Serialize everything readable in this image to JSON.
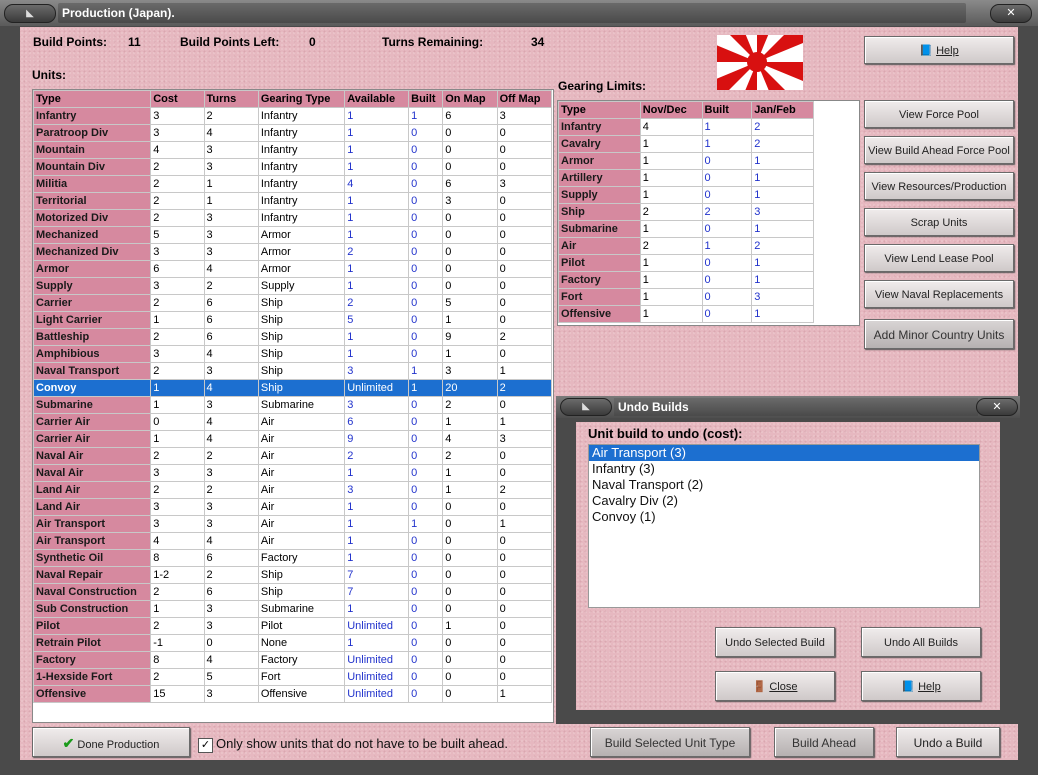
{
  "window": {
    "title": "Production (Japan).",
    "close_glyph": "✕"
  },
  "header": {
    "build_points_label": "Build Points:",
    "build_points": "11",
    "build_points_left_label": "Build Points Left:",
    "build_points_left": "0",
    "turns_remaining_label": "Turns Remaining:",
    "turns_remaining": "34"
  },
  "units": {
    "label": "Units:",
    "columns": [
      "Type",
      "Cost",
      "Turns",
      "Gearing Type",
      "Available",
      "Built",
      "On Map",
      "Off Map"
    ],
    "selected_index": 16,
    "rows": [
      [
        "Infantry",
        "3",
        "2",
        "Infantry",
        "1",
        "1",
        "6",
        "3"
      ],
      [
        "Paratroop Div",
        "3",
        "4",
        "Infantry",
        "1",
        "0",
        "0",
        "0"
      ],
      [
        "Mountain",
        "4",
        "3",
        "Infantry",
        "1",
        "0",
        "0",
        "0"
      ],
      [
        "Mountain Div",
        "2",
        "3",
        "Infantry",
        "1",
        "0",
        "0",
        "0"
      ],
      [
        "Militia",
        "2",
        "1",
        "Infantry",
        "4",
        "0",
        "6",
        "3"
      ],
      [
        "Territorial",
        "2",
        "1",
        "Infantry",
        "1",
        "0",
        "3",
        "0"
      ],
      [
        "Motorized Div",
        "2",
        "3",
        "Infantry",
        "1",
        "0",
        "0",
        "0"
      ],
      [
        "Mechanized",
        "5",
        "3",
        "Armor",
        "1",
        "0",
        "0",
        "0"
      ],
      [
        "Mechanized Div",
        "3",
        "3",
        "Armor",
        "2",
        "0",
        "0",
        "0"
      ],
      [
        "Armor",
        "6",
        "4",
        "Armor",
        "1",
        "0",
        "0",
        "0"
      ],
      [
        "Supply",
        "3",
        "2",
        "Supply",
        "1",
        "0",
        "0",
        "0"
      ],
      [
        "Carrier",
        "2",
        "6",
        "Ship",
        "2",
        "0",
        "5",
        "0"
      ],
      [
        "Light Carrier",
        "1",
        "6",
        "Ship",
        "5",
        "0",
        "1",
        "0"
      ],
      [
        "Battleship",
        "2",
        "6",
        "Ship",
        "1",
        "0",
        "9",
        "2"
      ],
      [
        "Amphibious",
        "3",
        "4",
        "Ship",
        "1",
        "0",
        "1",
        "0"
      ],
      [
        "Naval Transport",
        "2",
        "3",
        "Ship",
        "3",
        "1",
        "3",
        "1"
      ],
      [
        "Convoy",
        "1",
        "4",
        "Ship",
        "Unlimited",
        "1",
        "20",
        "2"
      ],
      [
        "Submarine",
        "1",
        "3",
        "Submarine",
        "3",
        "0",
        "2",
        "0"
      ],
      [
        "Carrier Air",
        "0",
        "4",
        "Air",
        "6",
        "0",
        "1",
        "1"
      ],
      [
        "Carrier Air",
        "1",
        "4",
        "Air",
        "9",
        "0",
        "4",
        "3"
      ],
      [
        "Naval Air",
        "2",
        "2",
        "Air",
        "2",
        "0",
        "2",
        "0"
      ],
      [
        "Naval Air",
        "3",
        "3",
        "Air",
        "1",
        "0",
        "1",
        "0"
      ],
      [
        "Land Air",
        "2",
        "2",
        "Air",
        "3",
        "0",
        "1",
        "2"
      ],
      [
        "Land Air",
        "3",
        "3",
        "Air",
        "1",
        "0",
        "0",
        "0"
      ],
      [
        "Air Transport",
        "3",
        "3",
        "Air",
        "1",
        "1",
        "0",
        "1"
      ],
      [
        "Air Transport",
        "4",
        "4",
        "Air",
        "1",
        "0",
        "0",
        "0"
      ],
      [
        "Synthetic Oil",
        "8",
        "6",
        "Factory",
        "1",
        "0",
        "0",
        "0"
      ],
      [
        "Naval Repair",
        "1-2",
        "2",
        "Ship",
        "7",
        "0",
        "0",
        "0"
      ],
      [
        "Naval Construction",
        "2",
        "6",
        "Ship",
        "7",
        "0",
        "0",
        "0"
      ],
      [
        "Sub Construction",
        "1",
        "3",
        "Submarine",
        "1",
        "0",
        "0",
        "0"
      ],
      [
        "Pilot",
        "2",
        "3",
        "Pilot",
        "Unlimited",
        "0",
        "1",
        "0"
      ],
      [
        "Retrain Pilot",
        "-1",
        "0",
        "None",
        "1",
        "0",
        "0",
        "0"
      ],
      [
        "Factory",
        "8",
        "4",
        "Factory",
        "Unlimited",
        "0",
        "0",
        "0"
      ],
      [
        "1-Hexside Fort",
        "2",
        "5",
        "Fort",
        "Unlimited",
        "0",
        "0",
        "0"
      ],
      [
        "Offensive",
        "15",
        "3",
        "Offensive",
        "Unlimited",
        "0",
        "0",
        "1"
      ]
    ]
  },
  "gearing": {
    "label": "Gearing Limits:",
    "columns": [
      "Type",
      "Nov/Dec",
      "Built",
      "Jan/Feb"
    ],
    "rows": [
      [
        "Infantry",
        "4",
        "1",
        "2"
      ],
      [
        "Cavalry",
        "1",
        "1",
        "2"
      ],
      [
        "Armor",
        "1",
        "0",
        "1"
      ],
      [
        "Artillery",
        "1",
        "0",
        "1"
      ],
      [
        "Supply",
        "1",
        "0",
        "1"
      ],
      [
        "Ship",
        "2",
        "2",
        "3"
      ],
      [
        "Submarine",
        "1",
        "0",
        "1"
      ],
      [
        "Air",
        "2",
        "1",
        "2"
      ],
      [
        "Pilot",
        "1",
        "0",
        "1"
      ],
      [
        "Factory",
        "1",
        "0",
        "1"
      ],
      [
        "Fort",
        "1",
        "0",
        "3"
      ],
      [
        "Offensive",
        "1",
        "0",
        "1"
      ]
    ]
  },
  "side_buttons": {
    "help": "Help",
    "view_force_pool": "View Force Pool",
    "view_build_ahead": "View Build Ahead Force Pool",
    "view_resources": "View Resources/Production",
    "scrap_units": "Scrap Units",
    "view_lend_lease": "View Lend Lease Pool",
    "view_naval_repl": "View Naval Replacements",
    "add_minor": "Add Minor Country Units"
  },
  "undo": {
    "title": "Undo Builds",
    "label": "Unit build to undo (cost):",
    "items": [
      "Air Transport (3)",
      "Infantry (3)",
      "Naval Transport (2)",
      "Cavalry Div (2)",
      "Convoy (1)"
    ],
    "selected_index": 0,
    "undo_selected": "Undo Selected Build",
    "undo_all": "Undo All Builds",
    "close": "Close",
    "help": "Help"
  },
  "footer": {
    "done": "Done Production",
    "checkbox_label": "Only show units that do not have to be built ahead.",
    "checkbox_checked": true,
    "build_selected": "Build Selected Unit Type",
    "build_ahead": "Build Ahead",
    "undo_build": "Undo a Build"
  },
  "colors": {
    "background_pink": "#e6b8c0",
    "header_pink": "#d6899f",
    "selection_blue": "#1c6fd0",
    "value_blue": "#2233cc"
  },
  "icons": [
    "book-icon",
    "checkmark-icon",
    "close-door-icon",
    "rising-sun-flag-icon"
  ]
}
